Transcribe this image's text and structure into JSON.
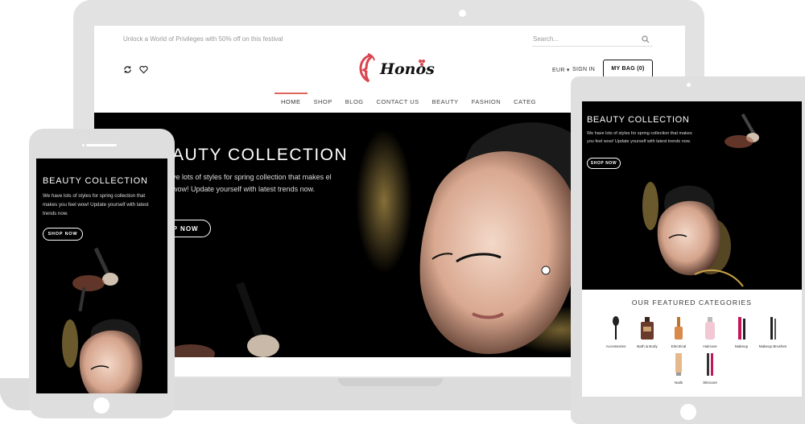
{
  "desktop": {
    "promo": "Unlock a World of Privileges with 50% off on this festival",
    "search_placeholder": "Search...",
    "logo_text": "Honos",
    "currency": "EUR ▾",
    "sign_in": "SIGN IN",
    "bag": "MY BAG (0)",
    "nav": [
      "HOME",
      "SHOP",
      "BLOG",
      "CONTACT US",
      "BEAUTY",
      "FASHION",
      "CATEG"
    ],
    "hero": {
      "title": "AUTY COLLECTION",
      "text": "ve lots of styles for spring collection that makes el wow! Update yourself with latest trends now.",
      "button": "OP NOW"
    }
  },
  "phone": {
    "title": "BEAUTY COLLECTION",
    "text": "We have lots of styles for spring collection that makes you feel wow! Update yourself with latest trends now.",
    "button": "SHOP NOW"
  },
  "tablet": {
    "title": "BEAUTY COLLECTION",
    "text": "We have lots of styles for spring collection that makes you feel wow! Update yourself with latest trends now.",
    "button": "SHOP NOW",
    "featured_heading": "OUR FEATURED CATEGORIES",
    "categories": [
      {
        "label": "Accessories",
        "icon": "brush-icon"
      },
      {
        "label": "Bath & Body",
        "icon": "perfume-bottle-icon"
      },
      {
        "label": "Electrical",
        "icon": "nail-polish-icon"
      },
      {
        "label": "Haircare",
        "icon": "cream-bottle-icon"
      },
      {
        "label": "Makeup",
        "icon": "lipstick-icon"
      },
      {
        "label": "Makeup Brushes",
        "icon": "makeup-brush-icon"
      },
      {
        "label": "Nails",
        "icon": "tube-icon"
      },
      {
        "label": "Skincare",
        "icon": "lipliner-icon"
      }
    ]
  },
  "colors": {
    "accent": "#e0655a",
    "device_frame": "#e2e2e2",
    "hero_bg": "#000000"
  }
}
